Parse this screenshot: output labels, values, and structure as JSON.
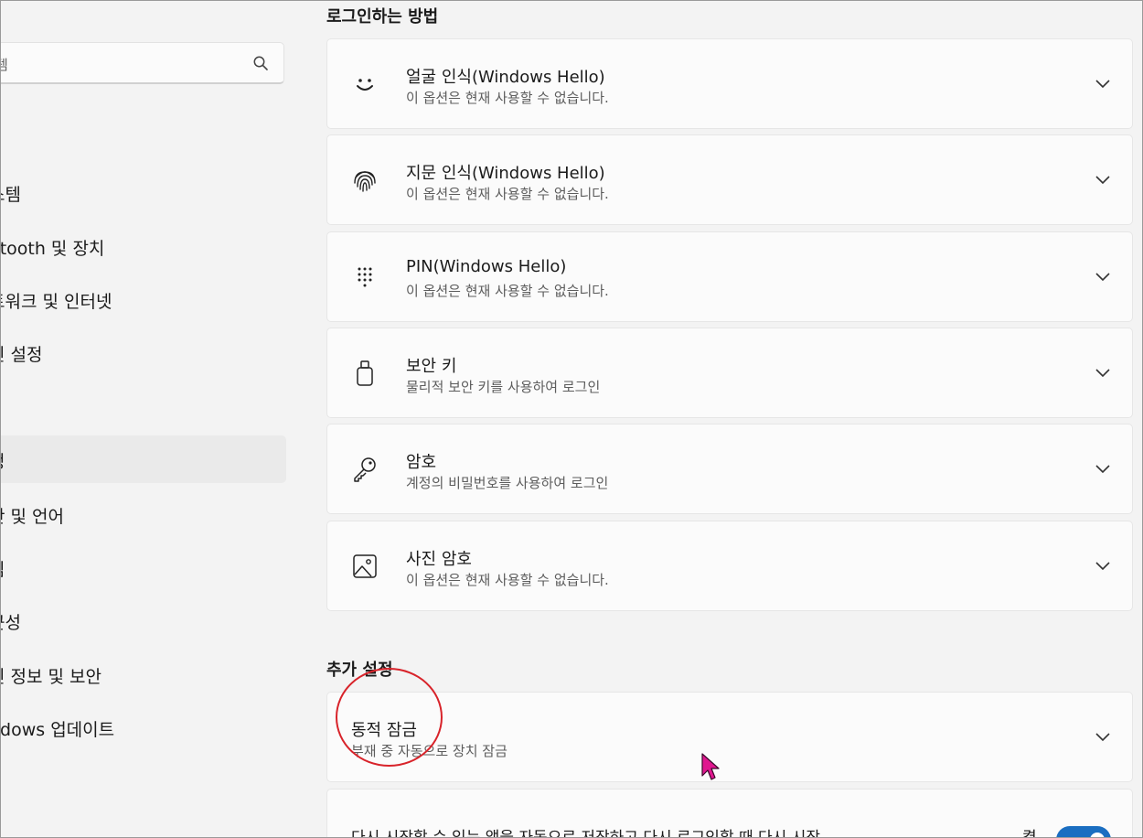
{
  "sidebar": {
    "search_placeholder": "템",
    "items": [
      {
        "label": "스템"
      },
      {
        "label": "etooth 및 장치"
      },
      {
        "label": "트워크 및 인터넷"
      },
      {
        "label": "인 설정"
      },
      {
        "label": "정"
      },
      {
        "label": "간 및 언어"
      },
      {
        "label": "임"
      },
      {
        "label": "근성"
      },
      {
        "label": "인 정보 및 보안"
      },
      {
        "label": "ndows 업데이트"
      }
    ]
  },
  "main": {
    "section_signin": "로그인하는 방법",
    "section_additional": "추가 설정",
    "signin_options": [
      {
        "icon": "smile-face-icon",
        "title": "얼굴 인식(Windows Hello)",
        "subtitle": "이 옵션은 현재 사용할 수 없습니다."
      },
      {
        "icon": "fingerprint-icon",
        "title": "지문 인식(Windows Hello)",
        "subtitle": "이 옵션은 현재 사용할 수 없습니다."
      },
      {
        "icon": "pin-keypad-icon",
        "title": "PIN(Windows Hello)",
        "subtitle": "이 옵션은 현재 사용할 수 없습니다."
      },
      {
        "icon": "usb-security-key-icon",
        "title": "보안 키",
        "subtitle": "물리적 보안 키를 사용하여 로그인"
      },
      {
        "icon": "key-icon",
        "title": "암호",
        "subtitle": "계정의 비밀번호를 사용하여 로그인"
      },
      {
        "icon": "picture-icon",
        "title": "사진 암호",
        "subtitle": "이 옵션은 현재 사용할 수 없습니다."
      }
    ],
    "dynamic_lock": {
      "title": "동적 잠금",
      "subtitle": "부재 중 자동으로 장치 잠금"
    },
    "restart_apps": {
      "text": "다시 시작할 수 있는 앱을 자동으로 저장하고 다시 로그인할 때 다시 시작",
      "state_label": "켬"
    }
  },
  "colors": {
    "accent": "#1a6ec1",
    "highlight_circle": "#d8232a",
    "cursor": "#e0168f"
  }
}
